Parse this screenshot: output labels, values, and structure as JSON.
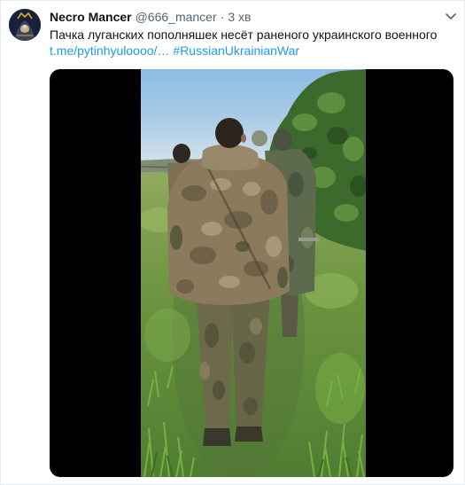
{
  "tweet": {
    "author": {
      "display_name": "Necro Mancer",
      "handle": "@666_mancer",
      "separator": "·",
      "timestamp": "3 хв"
    },
    "body": {
      "text": "Пачка луганских пополняшек несёт раненого украинского военного",
      "link": "t.me/pytinhyuloooo/…",
      "hashtag": "#RussianUkrainianWar"
    }
  },
  "icons": {
    "more_menu": "chevron-down-icon",
    "avatar": "avatar-image"
  },
  "colors": {
    "text_primary": "#0f1419",
    "text_secondary": "#536471",
    "link": "#1d9bf0",
    "media_background": "#000000"
  }
}
